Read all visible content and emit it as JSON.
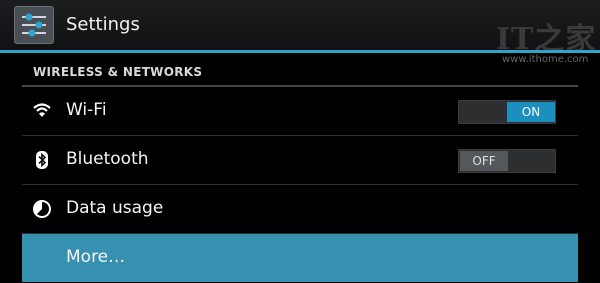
{
  "header": {
    "title": "Settings"
  },
  "watermark": {
    "logo": "IT之家",
    "url": "www.ithome.com"
  },
  "section": {
    "title": "WIRELESS & NETWORKS"
  },
  "items": [
    {
      "label": "Wi-Fi",
      "icon": "wifi-icon",
      "toggle": "ON"
    },
    {
      "label": "Bluetooth",
      "icon": "bluetooth-icon",
      "toggle": "OFF"
    },
    {
      "label": "Data usage",
      "icon": "data-usage-icon"
    },
    {
      "label": "More…",
      "selected": true
    }
  ],
  "colors": {
    "accent": "#2aa6cf",
    "selected_row": "#3690b0",
    "switch_on": "#1b8fc0"
  }
}
